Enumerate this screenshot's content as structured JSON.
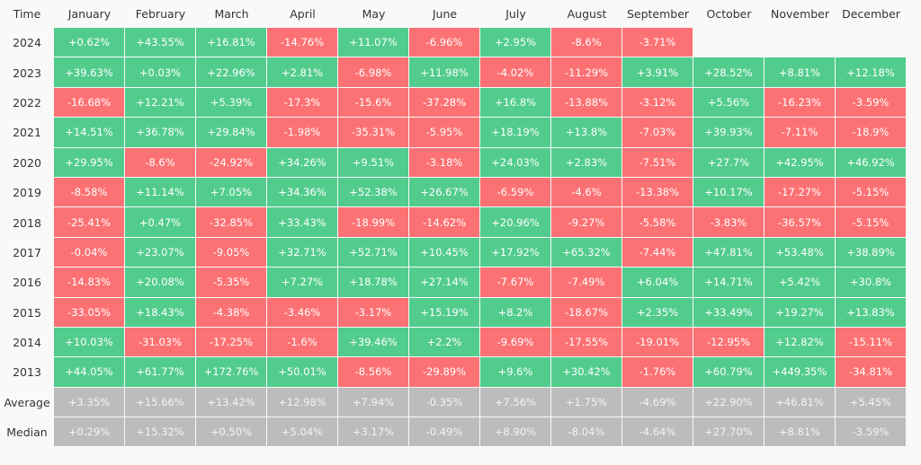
{
  "chart_data": {
    "type": "heatmap",
    "title": "",
    "corner_label": "Time",
    "columns": [
      "January",
      "February",
      "March",
      "April",
      "May",
      "June",
      "July",
      "August",
      "September",
      "October",
      "November",
      "December"
    ],
    "rows": [
      {
        "label": "2024",
        "values": [
          "+0.62%",
          "+43.55%",
          "+16.81%",
          "-14.76%",
          "+11.07%",
          "-6.96%",
          "+2.95%",
          "-8.6%",
          "-3.71%",
          null,
          null,
          null
        ]
      },
      {
        "label": "2023",
        "values": [
          "+39.63%",
          "+0.03%",
          "+22.96%",
          "+2.81%",
          "-6.98%",
          "+11.98%",
          "-4.02%",
          "-11.29%",
          "+3.91%",
          "+28.52%",
          "+8.81%",
          "+12.18%"
        ]
      },
      {
        "label": "2022",
        "values": [
          "-16.68%",
          "+12.21%",
          "+5.39%",
          "-17.3%",
          "-15.6%",
          "-37.28%",
          "+16.8%",
          "-13.88%",
          "-3.12%",
          "+5.56%",
          "-16.23%",
          "-3.59%"
        ]
      },
      {
        "label": "2021",
        "values": [
          "+14.51%",
          "+36.78%",
          "+29.84%",
          "-1.98%",
          "-35.31%",
          "-5.95%",
          "+18.19%",
          "+13.8%",
          "-7.03%",
          "+39.93%",
          "-7.11%",
          "-18.9%"
        ]
      },
      {
        "label": "2020",
        "values": [
          "+29.95%",
          "-8.6%",
          "-24.92%",
          "+34.26%",
          "+9.51%",
          "-3.18%",
          "+24.03%",
          "+2.83%",
          "-7.51%",
          "+27.7%",
          "+42.95%",
          "+46.92%"
        ]
      },
      {
        "label": "2019",
        "values": [
          "-8.58%",
          "+11.14%",
          "+7.05%",
          "+34.36%",
          "+52.38%",
          "+26.67%",
          "-6.59%",
          "-4.6%",
          "-13.38%",
          "+10.17%",
          "-17.27%",
          "-5.15%"
        ]
      },
      {
        "label": "2018",
        "values": [
          "-25.41%",
          "+0.47%",
          "-32.85%",
          "+33.43%",
          "-18.99%",
          "-14.62%",
          "+20.96%",
          "-9.27%",
          "-5.58%",
          "-3.83%",
          "-36.57%",
          "-5.15%"
        ]
      },
      {
        "label": "2017",
        "values": [
          "-0.04%",
          "+23.07%",
          "-9.05%",
          "+32.71%",
          "+52.71%",
          "+10.45%",
          "+17.92%",
          "+65.32%",
          "-7.44%",
          "+47.81%",
          "+53.48%",
          "+38.89%"
        ]
      },
      {
        "label": "2016",
        "values": [
          "-14.83%",
          "+20.08%",
          "-5.35%",
          "+7.27%",
          "+18.78%",
          "+27.14%",
          "-7.67%",
          "-7.49%",
          "+6.04%",
          "+14.71%",
          "+5.42%",
          "+30.8%"
        ]
      },
      {
        "label": "2015",
        "values": [
          "-33.05%",
          "+18.43%",
          "-4.38%",
          "-3.46%",
          "-3.17%",
          "+15.19%",
          "+8.2%",
          "-18.67%",
          "+2.35%",
          "+33.49%",
          "+19.27%",
          "+13.83%"
        ]
      },
      {
        "label": "2014",
        "values": [
          "+10.03%",
          "-31.03%",
          "-17.25%",
          "-1.6%",
          "+39.46%",
          "+2.2%",
          "-9.69%",
          "-17.55%",
          "-19.01%",
          "-12.95%",
          "+12.82%",
          "-15.11%"
        ]
      },
      {
        "label": "2013",
        "values": [
          "+44.05%",
          "+61.77%",
          "+172.76%",
          "+50.01%",
          "-8.56%",
          "-29.89%",
          "+9.6%",
          "+30.42%",
          "-1.76%",
          "+60.79%",
          "+449.35%",
          "-34.81%"
        ]
      }
    ],
    "summary_rows": [
      {
        "label": "Average",
        "values": [
          "+3.35%",
          "+15.66%",
          "+13.42%",
          "+12.98%",
          "+7.94%",
          "-0.35%",
          "+7.56%",
          "+1.75%",
          "-4.69%",
          "+22.90%",
          "+46.81%",
          "+5.45%"
        ]
      },
      {
        "label": "Median",
        "values": [
          "+0.29%",
          "+15.32%",
          "+0.50%",
          "+5.04%",
          "+3.17%",
          "-0.49%",
          "+8.90%",
          "-8.04%",
          "-4.64%",
          "+27.70%",
          "+8.81%",
          "-3.59%"
        ]
      }
    ],
    "colors": {
      "positive": "#52cc8d",
      "negative": "#fc7274",
      "summary": "#bcbcbc"
    }
  }
}
